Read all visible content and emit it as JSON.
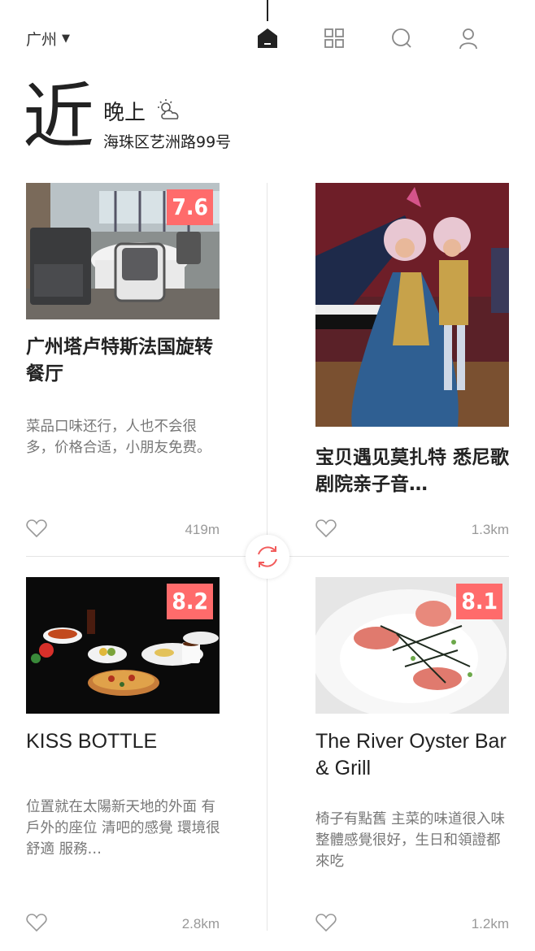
{
  "header": {
    "city": "广州",
    "hero_char": "近",
    "period": "晚上",
    "address": "海珠区艺洲路99号"
  },
  "nav": {
    "icons": [
      "home-icon",
      "grid-icon",
      "search-icon",
      "user-icon"
    ],
    "active": "home-icon"
  },
  "cards": [
    {
      "score": "7.6",
      "title": "广州塔卢特斯法国旋转餐厅",
      "desc": "菜品口味还行，人也不会很多，价格合适，小朋友免费。",
      "distance": "419m"
    },
    {
      "score": "",
      "title": "宝贝遇见莫扎特 悉尼歌剧院亲子音…",
      "desc": "",
      "distance": "1.3km"
    },
    {
      "score": "8.2",
      "title": "KISS BOTTLE",
      "desc": "位置就在太陽新天地的外面 有戶外的座位 清吧的感覺 環境很舒適 服務…",
      "distance": "2.8km"
    },
    {
      "score": "8.1",
      "title": "The River Oyster Bar & Grill",
      "desc": "椅子有點舊 主菜的味道很入味 整體感覺很好，生日和領證都來吃",
      "distance": "1.2km"
    }
  ],
  "colors": {
    "badge": "#ff6b6b",
    "refresh": "#f25c5c"
  }
}
